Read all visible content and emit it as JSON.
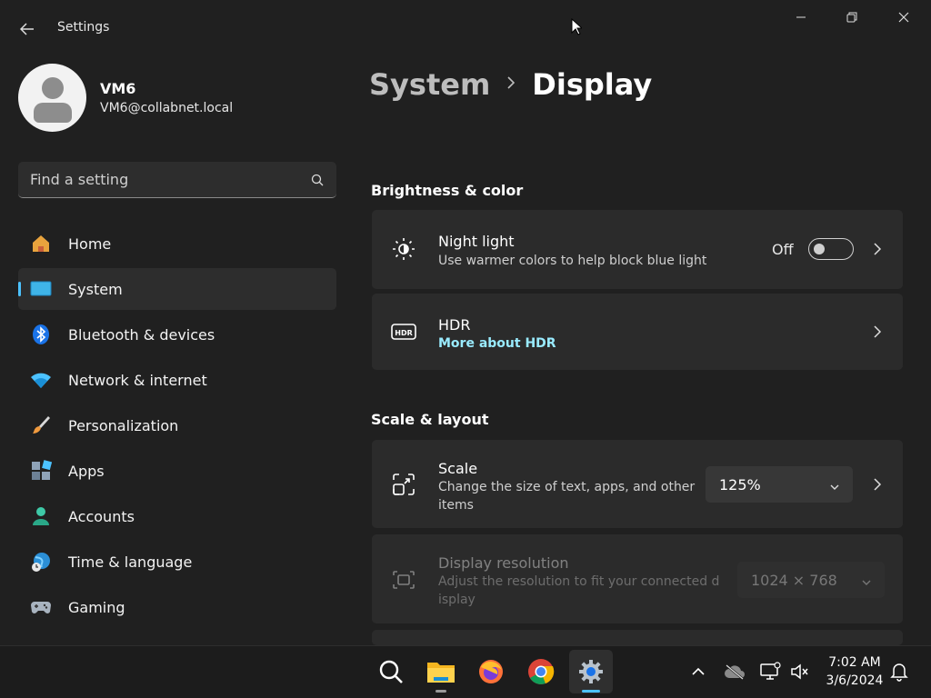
{
  "window": {
    "title": "Settings",
    "minimize_glyph": "─",
    "maximize_glyph": "❐",
    "close_glyph": "✕"
  },
  "profile": {
    "name": "VM6",
    "email": "VM6@collabnet.local"
  },
  "search": {
    "placeholder": "Find a setting",
    "icon": "search-icon"
  },
  "sidebar": {
    "items": [
      {
        "label": "Home",
        "icon": "home-icon",
        "active": false
      },
      {
        "label": "System",
        "icon": "system-icon",
        "active": true
      },
      {
        "label": "Bluetooth & devices",
        "icon": "bluetooth-icon",
        "active": false
      },
      {
        "label": "Network & internet",
        "icon": "wifi-icon",
        "active": false
      },
      {
        "label": "Personalization",
        "icon": "brush-icon",
        "active": false
      },
      {
        "label": "Apps",
        "icon": "apps-icon",
        "active": false
      },
      {
        "label": "Accounts",
        "icon": "accounts-icon",
        "active": false
      },
      {
        "label": "Time & language",
        "icon": "globe-clock-icon",
        "active": false
      },
      {
        "label": "Gaming",
        "icon": "controller-icon",
        "active": false
      }
    ]
  },
  "breadcrumb": {
    "parent": "System",
    "separator": ">",
    "current": "Display"
  },
  "sections": {
    "brightness": {
      "title": "Brightness & color",
      "night_light": {
        "title": "Night light",
        "description": "Use warmer colors to help block blue light",
        "state_label": "Off",
        "enabled": false
      },
      "hdr": {
        "title": "HDR",
        "link": "More about HDR",
        "icon_text": "HDR"
      }
    },
    "scale_layout": {
      "title": "Scale & layout",
      "scale": {
        "title": "Scale",
        "description": "Change the size of text, apps, and other items",
        "value": "125%"
      },
      "resolution": {
        "title": "Display resolution",
        "description": "Adjust the resolution to fit your connected display",
        "value": "1024 × 768",
        "disabled": true
      }
    }
  },
  "taskbar": {
    "apps": [
      "search-icon",
      "file-explorer-icon",
      "firefox-icon",
      "chrome-icon",
      "settings-icon"
    ],
    "active_app": "settings-icon",
    "tray": [
      "chevron-up-icon",
      "onedrive-icon",
      "network-icon",
      "volume-mute-icon"
    ],
    "time": "7:02 AM",
    "date": "3/6/2024"
  },
  "colors": {
    "accent": "#4cc2ff",
    "link": "#99ebff",
    "background": "#202020",
    "card": "#2b2b2b"
  }
}
